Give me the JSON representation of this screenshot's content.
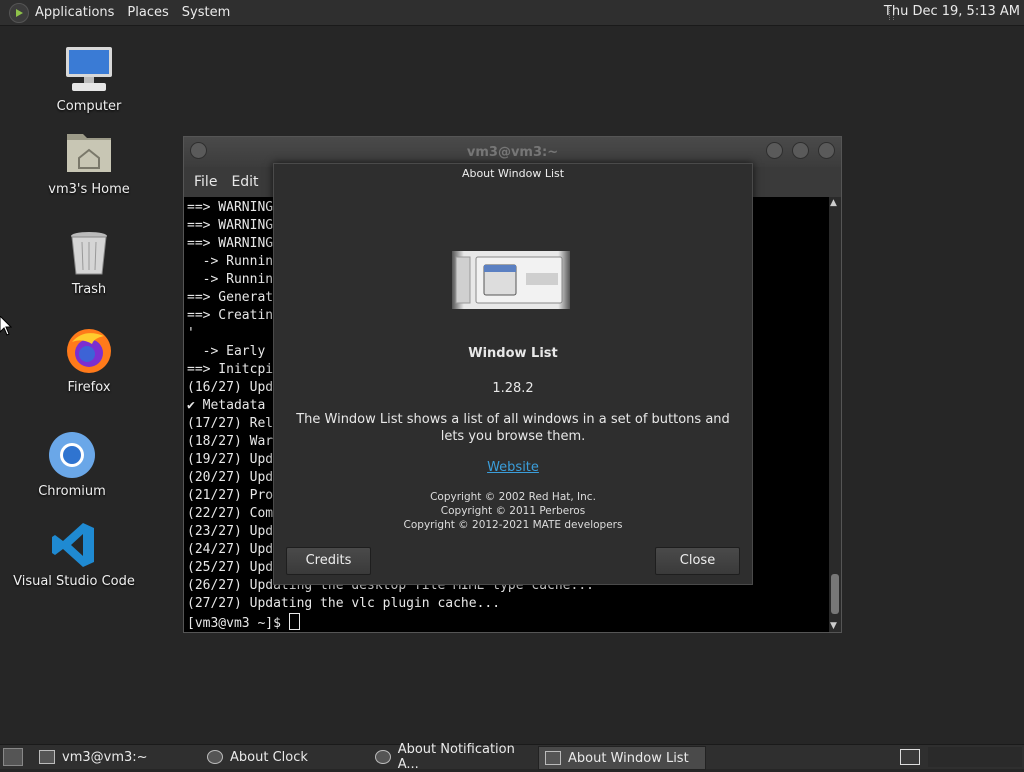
{
  "top_panel": {
    "menus": [
      "Applications",
      "Places",
      "System"
    ],
    "clock": "Thu Dec 19,  5:13 AM"
  },
  "desktop": {
    "icons": [
      {
        "label": "Computer",
        "icon": "computer-icon"
      },
      {
        "label": "vm3's Home",
        "icon": "home-folder-icon"
      },
      {
        "label": "Trash",
        "icon": "trash-icon"
      },
      {
        "label": "Firefox",
        "icon": "firefox-icon"
      },
      {
        "label": "Chromium",
        "icon": "chromium-icon"
      },
      {
        "label": "Visual Studio Code",
        "icon": "vscode-icon"
      }
    ]
  },
  "terminal": {
    "title": "vm3@vm3:~",
    "menu": [
      "File",
      "Edit"
    ],
    "lines": [
      "==> WARNING",
      "==> WARNING",
      "==> WARNING",
      "  -> Runnin",
      "  -> Runnin",
      "==> Generat",
      "==> Creatin                                                  lback.img",
      "'",
      "  -> Early",
      "==> Initcpi",
      "(16/27) Upd",
      "✔ Metadata",
      "(17/27) Rel",
      "(18/27) War",
      "(19/27) Upd",
      "(20/27) Upd",
      "(21/27) Pro",
      "(22/27) Com",
      "(23/27) Upd",
      "(24/27) Upd",
      "(25/27) Upd",
      "(26/27) Updating the desktop file MIME type cache...",
      "(27/27) Updating the vlc plugin cache..."
    ],
    "prompt": "[vm3@vm3 ~]$ "
  },
  "dialog": {
    "title": "About Window List",
    "app_name": "Window List",
    "version": "1.28.2",
    "description": "The Window List shows a list of all windows in a set of buttons and lets you browse them.",
    "website": "Website",
    "copyright": [
      "Copyright © 2002 Red Hat, Inc.",
      "Copyright © 2011 Perberos",
      "Copyright © 2012-2021 MATE developers"
    ],
    "credits_label": "Credits",
    "close_label": "Close"
  },
  "taskbar": {
    "tasks": [
      {
        "label": "vm3@vm3:~",
        "active": false
      },
      {
        "label": "About Clock",
        "active": false
      },
      {
        "label": "About Notification A...",
        "active": false
      },
      {
        "label": "About Window List",
        "active": true
      }
    ]
  },
  "colors": {
    "link": "#3b9edb",
    "panel": "#2f2f2f",
    "desktop": "#262626"
  }
}
